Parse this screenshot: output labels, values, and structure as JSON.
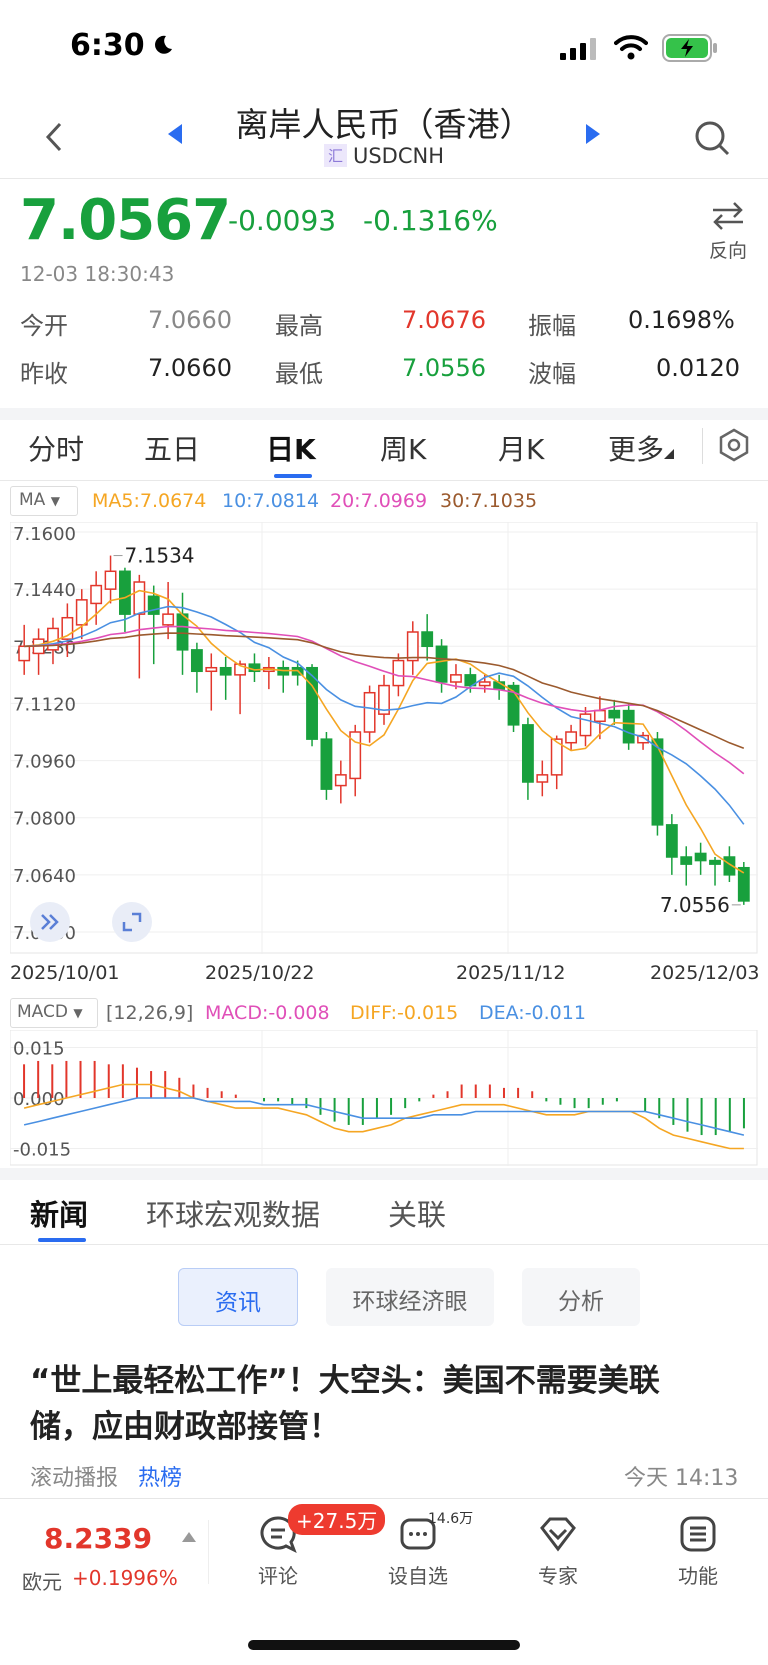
{
  "status_bar": {
    "time": "6:30"
  },
  "header": {
    "title": "离岸人民币（香港）",
    "symbol_badge": "汇",
    "symbol": "USDCNH"
  },
  "quote": {
    "price": "7.0567",
    "change": "-0.0093",
    "change_pct": "-0.1316%",
    "timestamp": "12-03 18:30:43",
    "reverse_label": "反向",
    "stats": {
      "open_label": "今开",
      "open": "7.0660",
      "high_label": "最高",
      "high": "7.0676",
      "amplitude_label": "振幅",
      "amplitude": "0.1698%",
      "prev_close_label": "昨收",
      "prev_close": "7.0660",
      "low_label": "最低",
      "low": "7.0556",
      "range_label": "波幅",
      "range": "0.0120"
    },
    "colors": {
      "down": "#18a03d",
      "up": "#e2362b"
    }
  },
  "chart_tabs": [
    "分时",
    "五日",
    "日K",
    "周K",
    "月K",
    "更多"
  ],
  "ma_legend": {
    "selector": "MA",
    "ma5": "MA5:7.0674",
    "ma10": "10:7.0814",
    "ma20": "20:7.0969",
    "ma30": "30:7.1035",
    "colors": {
      "ma5": "#f5a623",
      "ma10": "#4a90e2",
      "ma20": "#e04fb8",
      "ma30": "#9b5a2e"
    }
  },
  "chart_data": [
    {
      "type": "candlestick",
      "ylim": [
        7.048,
        7.16
      ],
      "yticks": [
        "7.1600",
        "7.1440",
        "7.1280",
        "7.1120",
        "7.0960",
        "7.0800",
        "7.0640",
        "7.0480"
      ],
      "x_labels": [
        "2025/10/01",
        "2025/10/22",
        "2025/11/12",
        "2025/12/03"
      ],
      "annotations": {
        "max_label": "7.1534",
        "max": 7.1534,
        "min_label": "7.0556",
        "min": 7.0556
      },
      "candles": [
        [
          7.124,
          7.128,
          7.12,
          7.134
        ],
        [
          7.126,
          7.13,
          7.12,
          7.133
        ],
        [
          7.127,
          7.133,
          7.123,
          7.136
        ],
        [
          7.13,
          7.136,
          7.125,
          7.14
        ],
        [
          7.134,
          7.141,
          7.13,
          7.144
        ],
        [
          7.14,
          7.145,
          7.134,
          7.149
        ],
        [
          7.144,
          7.149,
          7.14,
          7.1534
        ],
        [
          7.149,
          7.137,
          7.132,
          7.15
        ],
        [
          7.137,
          7.146,
          7.119,
          7.148
        ],
        [
          7.142,
          7.137,
          7.123,
          7.145
        ],
        [
          7.134,
          7.137,
          7.13,
          7.146
        ],
        [
          7.137,
          7.127,
          7.12,
          7.143
        ],
        [
          7.127,
          7.121,
          7.115,
          7.129
        ],
        [
          7.121,
          7.122,
          7.11,
          7.126
        ],
        [
          7.122,
          7.12,
          7.113,
          7.125
        ],
        [
          7.12,
          7.123,
          7.109,
          7.124
        ],
        [
          7.123,
          7.121,
          7.118,
          7.126
        ],
        [
          7.121,
          7.122,
          7.116,
          7.125
        ],
        [
          7.122,
          7.12,
          7.115,
          7.124
        ],
        [
          7.122,
          7.12,
          7.117,
          7.124
        ],
        [
          7.122,
          7.102,
          7.1,
          7.123
        ],
        [
          7.102,
          7.088,
          7.085,
          7.104
        ],
        [
          7.089,
          7.092,
          7.084,
          7.096
        ],
        [
          7.091,
          7.104,
          7.086,
          7.106
        ],
        [
          7.104,
          7.115,
          7.101,
          7.117
        ],
        [
          7.109,
          7.117,
          7.106,
          7.12
        ],
        [
          7.117,
          7.124,
          7.114,
          7.126
        ],
        [
          7.124,
          7.132,
          7.12,
          7.135
        ],
        [
          7.132,
          7.128,
          7.124,
          7.137
        ],
        [
          7.128,
          7.118,
          7.115,
          7.13
        ],
        [
          7.118,
          7.12,
          7.116,
          7.123
        ],
        [
          7.12,
          7.117,
          7.115,
          7.122
        ],
        [
          7.117,
          7.118,
          7.115,
          7.12
        ],
        [
          7.118,
          7.116,
          7.113,
          7.12
        ],
        [
          7.117,
          7.106,
          7.104,
          7.118
        ],
        [
          7.106,
          7.09,
          7.085,
          7.108
        ],
        [
          7.09,
          7.092,
          7.086,
          7.096
        ],
        [
          7.092,
          7.102,
          7.088,
          7.103
        ],
        [
          7.101,
          7.104,
          7.099,
          7.106
        ],
        [
          7.103,
          7.109,
          7.1,
          7.111
        ],
        [
          7.107,
          7.11,
          7.102,
          7.114
        ],
        [
          7.11,
          7.108,
          7.106,
          7.113
        ],
        [
          7.11,
          7.101,
          7.099,
          7.112
        ],
        [
          7.101,
          7.103,
          7.099,
          7.104
        ],
        [
          7.102,
          7.078,
          7.075,
          7.104
        ],
        [
          7.078,
          7.069,
          7.064,
          7.081
        ],
        [
          7.069,
          7.067,
          7.061,
          7.072
        ],
        [
          7.07,
          7.068,
          7.064,
          7.073
        ],
        [
          7.068,
          7.067,
          7.061,
          7.069
        ],
        [
          7.069,
          7.064,
          7.062,
          7.072
        ],
        [
          7.066,
          7.0567,
          7.0556,
          7.0676
        ]
      ]
    },
    {
      "type": "macd",
      "params": "[12,26,9]",
      "selector": "MACD",
      "macd_label": "MACD:-0.008",
      "diff_label": "DIFF:-0.015",
      "dea_label": "DEA:-0.011",
      "yticks": [
        "0.015",
        "0.000",
        "-0.015"
      ],
      "ylim": [
        -0.019,
        0.019
      ],
      "hist": [
        0.01,
        0.011,
        0.01,
        0.011,
        0.011,
        0.011,
        0.01,
        0.01,
        0.009,
        0.008,
        0.008,
        0.006,
        0.004,
        0.003,
        0.002,
        0.001,
        0.0,
        -0.001,
        -0.001,
        -0.002,
        -0.003,
        -0.005,
        -0.007,
        -0.008,
        -0.008,
        -0.006,
        -0.005,
        -0.003,
        -0.001,
        0.001,
        0.002,
        0.004,
        0.004,
        0.004,
        0.003,
        0.003,
        0.002,
        -0.001,
        -0.002,
        -0.003,
        -0.003,
        -0.002,
        -0.001,
        0.0,
        -0.004,
        -0.006,
        -0.008,
        -0.01,
        -0.011,
        -0.011,
        -0.01,
        -0.009
      ],
      "diff": [
        -0.003,
        -0.002,
        -0.001,
        0.0,
        0.001,
        0.002,
        0.003,
        0.004,
        0.004,
        0.004,
        0.003,
        0.002,
        0.0,
        -0.001,
        -0.002,
        -0.003,
        -0.003,
        -0.003,
        -0.003,
        -0.004,
        -0.005,
        -0.007,
        -0.009,
        -0.01,
        -0.01,
        -0.009,
        -0.008,
        -0.006,
        -0.005,
        -0.004,
        -0.003,
        -0.002,
        -0.002,
        -0.002,
        -0.002,
        -0.003,
        -0.004,
        -0.005,
        -0.005,
        -0.005,
        -0.004,
        -0.004,
        -0.004,
        -0.004,
        -0.006,
        -0.009,
        -0.011,
        -0.012,
        -0.013,
        -0.014,
        -0.015,
        -0.015
      ],
      "dea": [
        -0.008,
        -0.007,
        -0.006,
        -0.005,
        -0.004,
        -0.003,
        -0.002,
        -0.001,
        0.0,
        0.0,
        0.0,
        0.0,
        0.0,
        -0.001,
        -0.001,
        -0.001,
        -0.001,
        -0.002,
        -0.002,
        -0.002,
        -0.002,
        -0.003,
        -0.004,
        -0.005,
        -0.006,
        -0.006,
        -0.006,
        -0.006,
        -0.006,
        -0.005,
        -0.005,
        -0.005,
        -0.004,
        -0.004,
        -0.004,
        -0.004,
        -0.004,
        -0.004,
        -0.004,
        -0.004,
        -0.004,
        -0.004,
        -0.004,
        -0.004,
        -0.004,
        -0.005,
        -0.006,
        -0.007,
        -0.008,
        -0.009,
        -0.01,
        -0.011
      ]
    }
  ],
  "news": {
    "tabs": [
      "新闻",
      "环球宏观数据",
      "关联"
    ],
    "chips": [
      "资讯",
      "环球经济眼",
      "分析"
    ],
    "headline": "“世上最轻松工作”！大空头：美国不需要美联储，应由财政部接管！",
    "source": "滚动播报",
    "tag": "热榜",
    "time": "今天 14:13"
  },
  "bottom_bar": {
    "ticker_price": "8.2339",
    "ticker_name": "欧元",
    "ticker_pct": "+0.1996%",
    "comment_label": "评论",
    "comment_badge": "+27.5万",
    "watch_label": "设自选",
    "watch_badge": "14.6万",
    "expert_label": "专家",
    "function_label": "功能"
  }
}
